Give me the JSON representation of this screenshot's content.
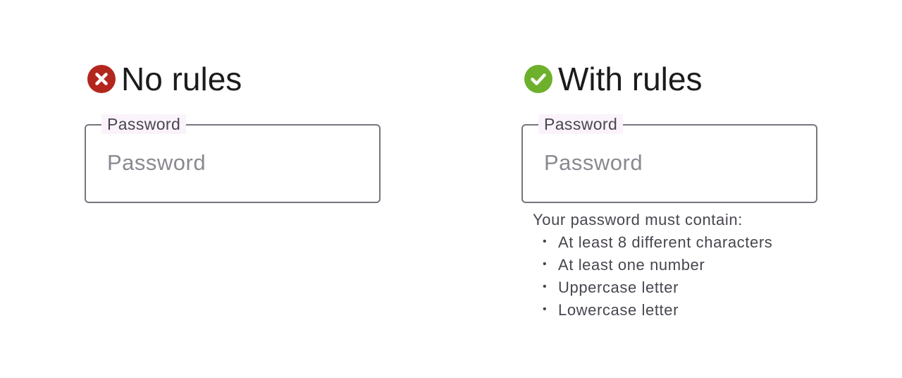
{
  "left_panel": {
    "status_icon": "error-x-icon",
    "status_color": "#b3261e",
    "heading": "No rules",
    "field": {
      "label": "Password",
      "placeholder": "Password",
      "value": ""
    }
  },
  "right_panel": {
    "status_icon": "success-check-icon",
    "status_color": "#6db02c",
    "heading": "With rules",
    "field": {
      "label": "Password",
      "placeholder": "Password",
      "value": ""
    },
    "rules": {
      "title": "Your password must contain:",
      "items": [
        "At least 8 different characters",
        "At least one number",
        "Uppercase letter",
        "Lowercase letter"
      ]
    }
  },
  "colors": {
    "outline": "#79757f",
    "label_background": "#fbf3fb",
    "supporting_text": "#49454f"
  }
}
